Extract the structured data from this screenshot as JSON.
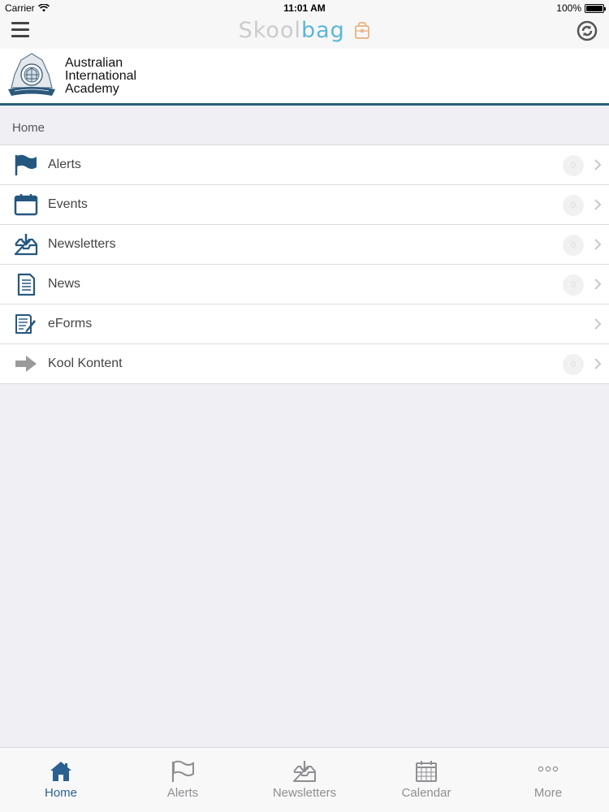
{
  "status_bar": {
    "carrier": "Carrier",
    "time": "11:01 AM",
    "battery": "100%",
    "battery_level": 1.0
  },
  "nav_bar": {
    "brand_part1": "Skool",
    "brand_part2": "bag",
    "menu_icon": "hamburger-icon",
    "sync_icon": "sync-icon"
  },
  "school": {
    "name_line1": "Australian",
    "name_line2": "International",
    "name_line3": "Academy"
  },
  "breadcrumb": "Home",
  "menu": {
    "items": [
      {
        "label": "Alerts",
        "icon": "flag-icon",
        "badge": "0"
      },
      {
        "label": "Events",
        "icon": "calendar-icon",
        "badge": "0"
      },
      {
        "label": "Newsletters",
        "icon": "inbox-download-icon",
        "badge": "0"
      },
      {
        "label": "News",
        "icon": "document-icon",
        "badge": "0"
      },
      {
        "label": "eForms",
        "icon": "form-pencil-icon",
        "badge": ""
      },
      {
        "label": "Kool Kontent",
        "icon": "arrow-right-icon",
        "badge": "0"
      }
    ]
  },
  "tabs": [
    {
      "label": "Home",
      "icon": "home-icon",
      "active": true
    },
    {
      "label": "Alerts",
      "icon": "flag-icon",
      "active": false
    },
    {
      "label": "Newsletters",
      "icon": "inbox-download-icon",
      "active": false
    },
    {
      "label": "Calendar",
      "icon": "calendar-icon",
      "active": false
    },
    {
      "label": "More",
      "icon": "more-icon",
      "active": false
    }
  ],
  "colors": {
    "accent": "#2a6190",
    "icon_blue": "#24577f",
    "header_border": "#2b5d7c",
    "brand_gray": "#c9cbcd",
    "brand_teal": "#5bb7d6",
    "inactive_tab": "#8e8e93"
  }
}
